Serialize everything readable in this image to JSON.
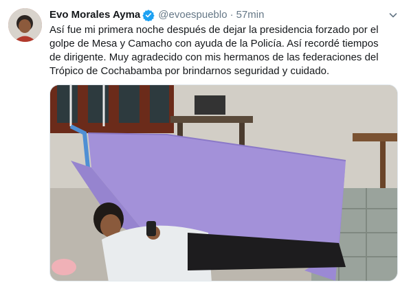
{
  "tweet": {
    "author_name": "Evo Morales Ayma",
    "handle": "@evoespueblo",
    "separator": "·",
    "time": "57min",
    "text_lines": [
      "Así fue mi primera noche después de dejar la presidencia forzado por el",
      "golpe de Mesa y Camacho con ayuda de la Policía. Así recordé tiempos",
      "de dirigente. Muy agradecido con mis hermanos de las federaciones del",
      "Trópico de Cochabamba por brindarnos seguridad y cuidado."
    ],
    "verified": true
  },
  "icons": {
    "verified": "verified-badge-icon",
    "menu": "chevron-down-icon"
  },
  "colors": {
    "name": "#14171a",
    "secondary": "#657786",
    "verified_badge": "#1da1f2",
    "hammock": "#a391d9"
  }
}
